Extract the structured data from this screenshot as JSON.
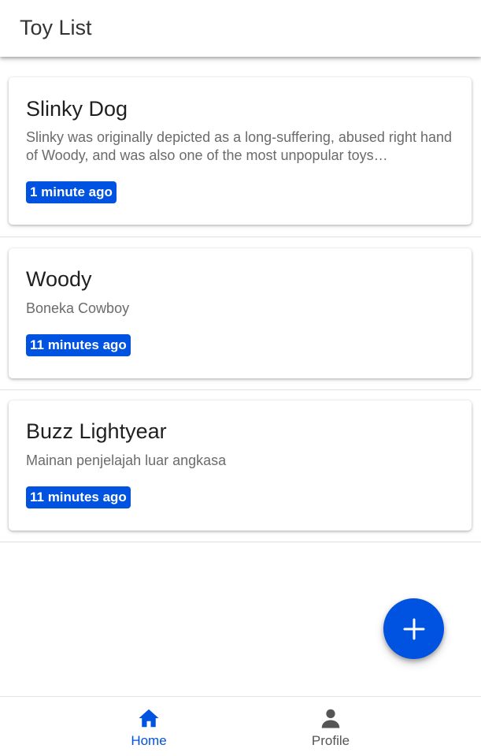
{
  "app_bar": {
    "title": "Toy List"
  },
  "toys": [
    {
      "name": "Slinky Dog",
      "description": "Slinky was originally depicted as a long-suffering, abused right hand of Woody, and was also one of the most unpopular toys…",
      "time": "1 minute ago"
    },
    {
      "name": "Woody",
      "description": "Boneka Cowboy",
      "time": "11 minutes ago"
    },
    {
      "name": "Buzz Lightyear",
      "description": "Mainan penjelajah luar angkasa",
      "time": "11 minutes ago"
    }
  ],
  "fab": {
    "icon": "plus-icon"
  },
  "bottom_nav": {
    "items": [
      {
        "label": "Home",
        "icon": "home-icon",
        "active": true
      },
      {
        "label": "Profile",
        "icon": "person-icon",
        "active": false
      }
    ]
  },
  "colors": {
    "accent": "#0052e0",
    "inactive_nav": "#555555",
    "text_secondary": "#6b6b6b"
  }
}
